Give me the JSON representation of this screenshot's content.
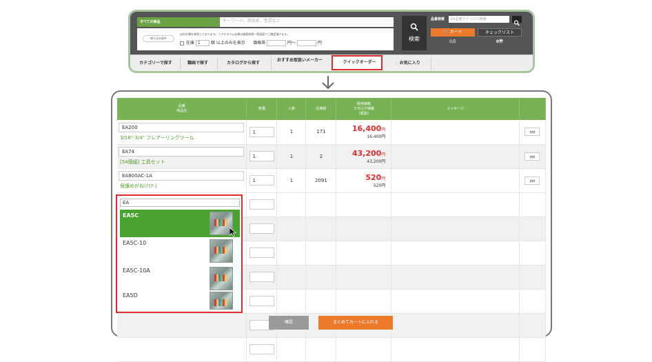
{
  "search_bar": {
    "all_products_label": "すべての商品",
    "keyword_placeholder": "キーワード、商品名、型式など",
    "filter_label": "絞り込み条件",
    "filter_note": "自社在庫を参照しております。リアルタイム在庫は検索結果一覧画面でご確認頂けます。",
    "stock_label": "在庫",
    "stock_value": "1",
    "stock_suffix": "個 以上のみを表示",
    "price_range_label": "価格帯",
    "price_from_suffix": "円〜",
    "price_to_suffix": "円",
    "search_button_label": "検索",
    "part_search_label": "品番検索",
    "part_search_placeholder": "EA品番でイッパツ検索",
    "cart_label": "カート",
    "cart_count": "0点",
    "checklist_label": "チェックリスト",
    "checklist_count": "0件"
  },
  "nav": {
    "items": [
      {
        "label": "カテゴリーで探す"
      },
      {
        "label": "類画で探す"
      },
      {
        "label": "カタログから探す"
      },
      {
        "label": "おすすめ取扱いメーカー"
      },
      {
        "label": "クイックオーダー"
      },
      {
        "label": "お気に入り"
      }
    ]
  },
  "table": {
    "headers": {
      "code_name_1": "品番",
      "code_name_2": "商品名",
      "quantity": "数量",
      "pack": "入数",
      "stock": "在庫数",
      "price_1": "販売価格",
      "price_2": "カタログ価格",
      "price_3": "(税抜)",
      "message": "メッセージ"
    },
    "rows": [
      {
        "code": "EA200",
        "name": "3/16\"-3/4\" フレアーリングツール",
        "qty": "1",
        "pack": "1",
        "stock": "171",
        "price": "16,400",
        "catalog_price": "16,400円",
        "delete": "削除"
      },
      {
        "code": "EA74",
        "name": "[54個組] 工具セット",
        "qty": "1",
        "pack": "1",
        "stock": "2",
        "price": "43,200",
        "catalog_price": "43,200円",
        "delete": "削除"
      },
      {
        "code": "EA800AC-1A",
        "name": "保護めがね(ｸﾘｱ-)",
        "qty": "1",
        "pack": "1",
        "stock": "2091",
        "price": "520",
        "catalog_price": "520円",
        "delete": "削除"
      }
    ],
    "price_unit": "円"
  },
  "suggest": {
    "input_value": "EA",
    "items": [
      {
        "code": "EA5C"
      },
      {
        "code": "EA5C-10"
      },
      {
        "code": "EA5C-10A"
      },
      {
        "code": "EA5D"
      }
    ]
  },
  "footer": {
    "confirm_label": "確認",
    "add_to_cart_label": "まとめてカートに入れる"
  }
}
